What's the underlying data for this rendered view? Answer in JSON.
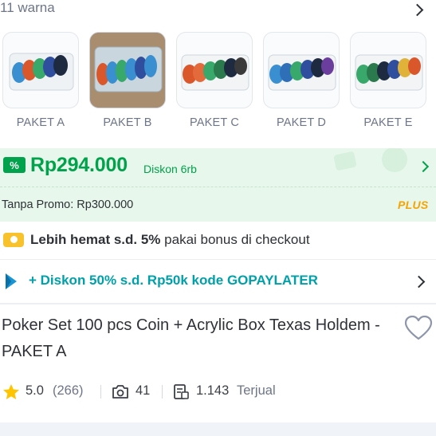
{
  "variants": {
    "count_label": "11 warna",
    "items": [
      {
        "label": "PAKET A",
        "selected": false
      },
      {
        "label": "PAKET B",
        "selected": true
      },
      {
        "label": "PAKET C",
        "selected": false
      },
      {
        "label": "PAKET D",
        "selected": false
      },
      {
        "label": "PAKET E",
        "selected": false
      }
    ]
  },
  "price": {
    "amount": "Rp294.000",
    "discount": "Diskon 6rb",
    "original": "Tanpa Promo: Rp300.000",
    "badge": "PLUS",
    "color": "#00a24b"
  },
  "promo": {
    "hemat_bold": "Lebih hemat s.d. 5%",
    "hemat_rest": " pakai bonus di checkout",
    "gopay": "+ Diskon 50% s.d. Rp50k kode GOPAYLATER"
  },
  "product": {
    "title": "Poker Set 100 pcs Coin + Acrylic Box Texas Holdem - PAKET A"
  },
  "stats": {
    "rating": "5.0",
    "reviews": "(266)",
    "photos": "41",
    "sold_count": "1.143",
    "sold_label": "Terjual"
  },
  "icons": [
    "chevron-right-icon",
    "voucher-icon",
    "coins-icon",
    "gopay-icon",
    "heart-icon",
    "star-icon",
    "camera-icon",
    "receipt-icon"
  ]
}
